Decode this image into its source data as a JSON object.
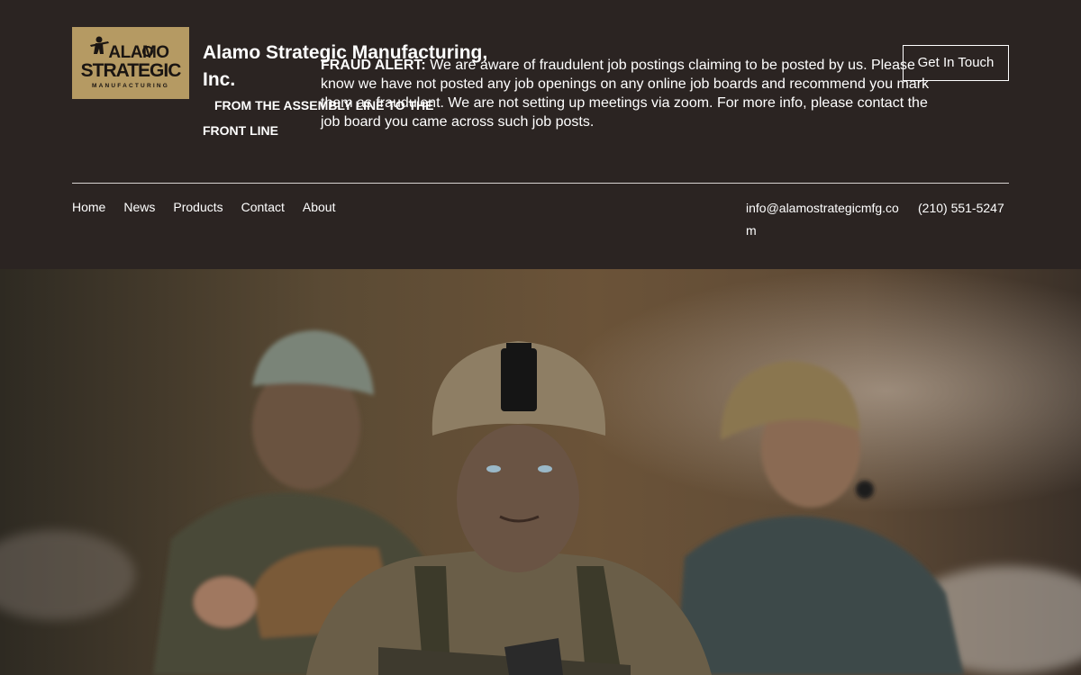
{
  "header": {
    "logo": {
      "line1": "ALAMO",
      "line2": "STRATEGIC",
      "line3": "MANUFACTURING"
    },
    "site_title": "Alamo Strategic Manufacturing, Inc.",
    "tagline": "FROM THE ASSEMBLY LINE TO THE FRONT LINE",
    "fraud_alert": {
      "label": "FRAUD ALERT:",
      "text": "We are aware of fraudulent job postings claiming to be posted by us.  Please know we have not posted any job openings on any online job boards and recommend you mark them as fraudulent.  We are not setting up meetings via zoom.  For more info, please contact the job board you came across such job posts."
    },
    "cta_label": "Get In Touch"
  },
  "nav": {
    "items": [
      {
        "label": "Home"
      },
      {
        "label": "News"
      },
      {
        "label": "Products"
      },
      {
        "label": "Contact"
      },
      {
        "label": "About"
      }
    ]
  },
  "contact": {
    "email": "info@alamostrategicmfg.com",
    "phone": "(210) 551-5247"
  },
  "colors": {
    "header_bg": "#2b2422",
    "logo_bg": "#b59a63",
    "text": "#ffffff"
  },
  "hero": {
    "image_icon": "soldiers-photo"
  }
}
